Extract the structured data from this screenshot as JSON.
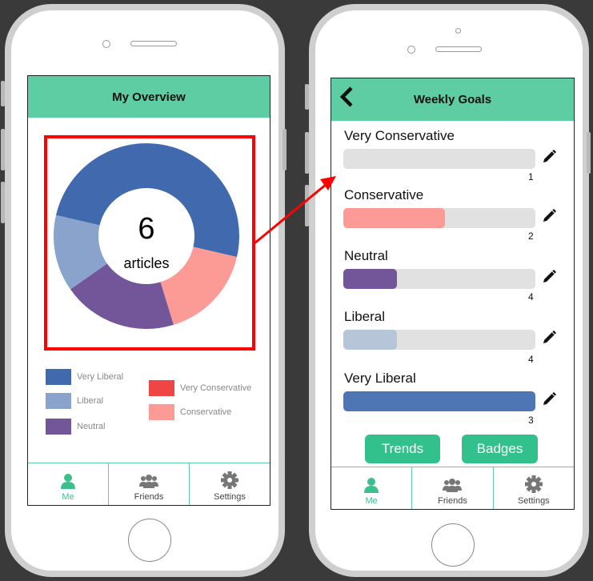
{
  "overview": {
    "title": "My Overview",
    "donut_count": "6",
    "donut_unit": "articles",
    "legend": [
      {
        "label": "Very Liberal",
        "color": "#4169ae"
      },
      {
        "label": "Liberal",
        "color": "#8aa3cc"
      },
      {
        "label": "Neutral",
        "color": "#73559a"
      },
      {
        "label": "Very Conservative",
        "color": "#f04545"
      },
      {
        "label": "Conservative",
        "color": "#fc9b96"
      }
    ],
    "tabs": [
      {
        "label": "Me",
        "icon": "person-icon"
      },
      {
        "label": "Friends",
        "icon": "friends-icon"
      },
      {
        "label": "Settings",
        "icon": "gear-icon"
      }
    ]
  },
  "chart_data": {
    "type": "pie",
    "categories": [
      "Very Liberal",
      "Conservative",
      "Neutral",
      "Liberal"
    ],
    "values": [
      3,
      1,
      1.2,
      0.8
    ],
    "colors": [
      "#4169ae",
      "#fc9b96",
      "#73559a",
      "#8aa3cc"
    ]
  },
  "goals": {
    "title": "Weekly Goals",
    "back_icon": "chevron-left-icon",
    "items": [
      {
        "label": "Very Conservative",
        "count": "1",
        "progress": 0,
        "color": "#fa6f6f"
      },
      {
        "label": "Conservative",
        "count": "2",
        "progress": 0.53,
        "color": "#fc9b96"
      },
      {
        "label": "Neutral",
        "count": "4",
        "progress": 0.28,
        "color": "#73559a"
      },
      {
        "label": "Liberal",
        "count": "4",
        "progress": 0.28,
        "color": "#b7c5d9"
      },
      {
        "label": "Very Liberal",
        "count": "3",
        "progress": 1.0,
        "color": "#4e75b4"
      }
    ],
    "buttons": {
      "trends": "Trends",
      "badges": "Badges"
    },
    "tabs": [
      {
        "label": "Me",
        "icon": "person-icon"
      },
      {
        "label": "Friends",
        "icon": "friends-icon"
      },
      {
        "label": "Settings",
        "icon": "gear-icon"
      }
    ]
  },
  "colors": {
    "header": "#5ecda4",
    "accent": "#32c08c",
    "highlight": "#ff0000"
  }
}
